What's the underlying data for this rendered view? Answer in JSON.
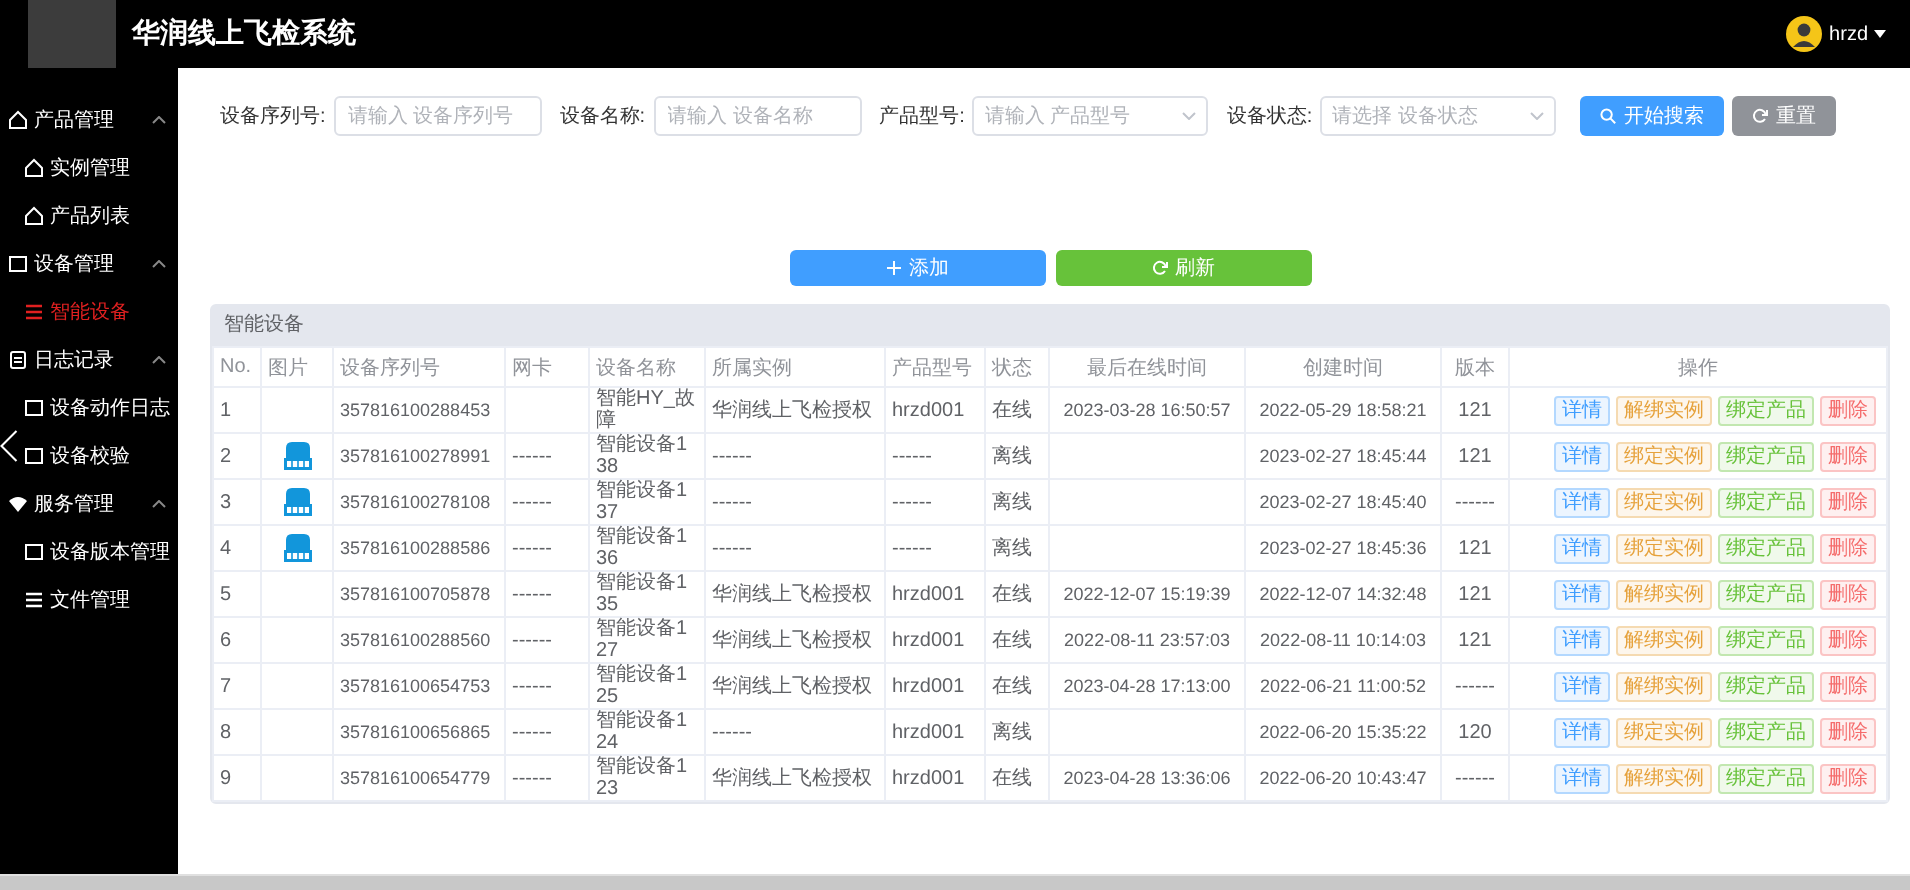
{
  "header": {
    "title": "华润线上飞检系统",
    "user": "hrzd"
  },
  "sidebar": {
    "groups": [
      {
        "label": "产品管理",
        "expanded": true,
        "children": [
          {
            "label": "实例管理",
            "selected": false
          },
          {
            "label": "产品列表",
            "selected": false
          }
        ]
      },
      {
        "label": "设备管理",
        "expanded": true,
        "children": [
          {
            "label": "智能设备",
            "selected": true
          }
        ]
      },
      {
        "label": "日志记录",
        "expanded": true,
        "children": [
          {
            "label": "设备动作日志",
            "selected": false
          },
          {
            "label": "设备校验",
            "selected": false
          }
        ]
      },
      {
        "label": "服务管理",
        "expanded": true,
        "children": [
          {
            "label": "设备版本管理",
            "selected": false
          },
          {
            "label": "文件管理",
            "selected": false
          }
        ]
      }
    ]
  },
  "filters": [
    {
      "label": "设备序列号:",
      "kind": "input",
      "placeholder": "请输入 设备序列号"
    },
    {
      "label": "设备名称:",
      "kind": "input",
      "placeholder": "请输入 设备名称"
    },
    {
      "label": "产品型号:",
      "kind": "select",
      "placeholder": "请输入 产品型号"
    },
    {
      "label": "设备状态:",
      "kind": "select",
      "placeholder": "请选择 设备状态"
    }
  ],
  "search_buttons": [
    {
      "label": "开始搜索",
      "kind": "search"
    },
    {
      "label": "重置",
      "kind": "reset"
    }
  ],
  "action_buttons": [
    {
      "label": "添加",
      "kind": "add"
    },
    {
      "label": "刷新",
      "kind": "refresh"
    }
  ],
  "table": {
    "title": "智能设备",
    "columns": [
      "No.",
      "图片",
      "设备序列号",
      "网卡",
      "设备名称",
      "所属实例",
      "产品型号",
      "状态",
      "最后在线时间",
      "创建时间",
      "版本",
      "操作"
    ],
    "rows": [
      {
        "no": "1",
        "image": false,
        "serial": "357816100288453",
        "name": "智能HY_故障",
        "instance": "华润线上飞检授权",
        "model": "hrzd001",
        "status": "在线",
        "last_online": "2023-03-28 16:50:57",
        "created": "2022-05-29 18:58:21",
        "version": "121",
        "actions": [
          {
            "label": "详情",
            "kind": "detail"
          },
          {
            "label": "解绑实例",
            "kind": "instance"
          },
          {
            "label": "绑定产品",
            "kind": "product"
          },
          {
            "label": "删除",
            "kind": "delete"
          }
        ]
      },
      {
        "no": "2",
        "image": true,
        "serial": "357816100278991",
        "nic": "------",
        "name": "智能设备138",
        "instance": "------",
        "model": "------",
        "status": "离线",
        "created": "2023-02-27 18:45:44",
        "version": "121",
        "actions": [
          {
            "label": "详情",
            "kind": "detail"
          },
          {
            "label": "绑定实例",
            "kind": "instance"
          },
          {
            "label": "绑定产品",
            "kind": "product"
          },
          {
            "label": "删除",
            "kind": "delete"
          }
        ]
      },
      {
        "no": "3",
        "image": true,
        "serial": "357816100278108",
        "nic": "------",
        "name": "智能设备137",
        "instance": "------",
        "model": "------",
        "status": "离线",
        "created": "2023-02-27 18:45:40",
        "version": "------",
        "actions": [
          {
            "label": "详情",
            "kind": "detail"
          },
          {
            "label": "绑定实例",
            "kind": "instance"
          },
          {
            "label": "绑定产品",
            "kind": "product"
          },
          {
            "label": "删除",
            "kind": "delete"
          }
        ]
      },
      {
        "no": "4",
        "image": true,
        "serial": "357816100288586",
        "nic": "------",
        "name": "智能设备136",
        "instance": "------",
        "model": "------",
        "status": "离线",
        "created": "2023-02-27 18:45:36",
        "version": "121",
        "actions": [
          {
            "label": "详情",
            "kind": "detail"
          },
          {
            "label": "绑定实例",
            "kind": "instance"
          },
          {
            "label": "绑定产品",
            "kind": "product"
          },
          {
            "label": "删除",
            "kind": "delete"
          }
        ]
      },
      {
        "no": "5",
        "image": false,
        "serial": "357816100705878",
        "nic": "------",
        "name": "智能设备135",
        "instance": "华润线上飞检授权",
        "model": "hrzd001",
        "status": "在线",
        "last_online": "2022-12-07 15:19:39",
        "created": "2022-12-07 14:32:48",
        "version": "121",
        "actions": [
          {
            "label": "详情",
            "kind": "detail"
          },
          {
            "label": "解绑实例",
            "kind": "instance"
          },
          {
            "label": "绑定产品",
            "kind": "product"
          },
          {
            "label": "删除",
            "kind": "delete"
          }
        ]
      },
      {
        "no": "6",
        "image": false,
        "serial": "357816100288560",
        "nic": "------",
        "name": "智能设备127",
        "instance": "华润线上飞检授权",
        "model": "hrzd001",
        "status": "在线",
        "last_online": "2022-08-11 23:57:03",
        "created": "2022-08-11 10:14:03",
        "version": "121",
        "actions": [
          {
            "label": "详情",
            "kind": "detail"
          },
          {
            "label": "解绑实例",
            "kind": "instance"
          },
          {
            "label": "绑定产品",
            "kind": "product"
          },
          {
            "label": "删除",
            "kind": "delete"
          }
        ]
      },
      {
        "no": "7",
        "image": false,
        "serial": "357816100654753",
        "nic": "------",
        "name": "智能设备125",
        "instance": "华润线上飞检授权",
        "model": "hrzd001",
        "status": "在线",
        "last_online": "2023-04-28 17:13:00",
        "created": "2022-06-21 11:00:52",
        "version": "------",
        "actions": [
          {
            "label": "详情",
            "kind": "detail"
          },
          {
            "label": "解绑实例",
            "kind": "instance"
          },
          {
            "label": "绑定产品",
            "kind": "product"
          },
          {
            "label": "删除",
            "kind": "delete"
          }
        ]
      },
      {
        "no": "8",
        "image": false,
        "serial": "357816100656865",
        "nic": "------",
        "name": "智能设备124",
        "instance": "------",
        "model": "hrzd001",
        "status": "离线",
        "created": "2022-06-20 15:35:22",
        "version": "120",
        "actions": [
          {
            "label": "详情",
            "kind": "detail"
          },
          {
            "label": "绑定实例",
            "kind": "instance"
          },
          {
            "label": "绑定产品",
            "kind": "product"
          },
          {
            "label": "删除",
            "kind": "delete"
          }
        ]
      },
      {
        "no": "9",
        "image": false,
        "serial": "357816100654779",
        "nic": "------",
        "name": "智能设备123",
        "instance": "华润线上飞检授权",
        "model": "hrzd001",
        "status": "在线",
        "last_online": "2023-04-28 13:36:06",
        "created": "2022-06-20 10:43:47",
        "version": "------",
        "actions": [
          {
            "label": "详情",
            "kind": "detail"
          },
          {
            "label": "解绑实例",
            "kind": "instance"
          },
          {
            "label": "绑定产品",
            "kind": "product"
          },
          {
            "label": "删除",
            "kind": "delete"
          }
        ]
      }
    ]
  }
}
